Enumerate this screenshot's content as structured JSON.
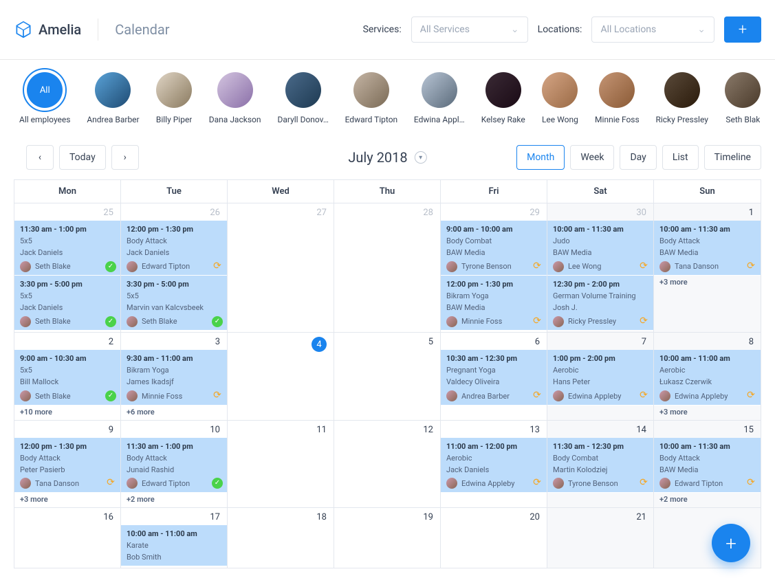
{
  "brand": "Amelia",
  "page_title": "Calendar",
  "filters": {
    "services_label": "Services:",
    "services_placeholder": "All Services",
    "locations_label": "Locations:",
    "locations_placeholder": "All Locations"
  },
  "employees": [
    {
      "name": "All employees",
      "all": true,
      "label": "All"
    },
    {
      "name": "Andrea Barber"
    },
    {
      "name": "Billy Piper"
    },
    {
      "name": "Dana Jackson"
    },
    {
      "name": "Daryll Donov…"
    },
    {
      "name": "Edward Tipton"
    },
    {
      "name": "Edwina Appl…"
    },
    {
      "name": "Kelsey Rake"
    },
    {
      "name": "Lee Wong"
    },
    {
      "name": "Minnie Foss"
    },
    {
      "name": "Ricky Pressley"
    },
    {
      "name": "Seth Blak"
    }
  ],
  "toolbar": {
    "today": "Today",
    "month_label": "July 2018",
    "views": [
      "Month",
      "Week",
      "Day",
      "List",
      "Timeline"
    ],
    "active_view": "Month"
  },
  "day_headers": [
    "Mon",
    "Tue",
    "Wed",
    "Thu",
    "Fri",
    "Sat",
    "Sun"
  ],
  "weeks": [
    [
      {
        "n": 25,
        "other": true,
        "events": [
          {
            "time": "11:30 am - 1:00 pm",
            "svc": "5x5",
            "loc": "Jack Daniels",
            "att": "Seth Blake",
            "status": "approved"
          },
          {
            "time": "3:30 pm - 5:00 pm",
            "svc": "5x5",
            "loc": "Jack Daniels",
            "att": "Seth Blake",
            "status": "approved"
          }
        ]
      },
      {
        "n": 26,
        "other": true,
        "events": [
          {
            "time": "12:00 pm - 1:30 pm",
            "svc": "Body Attack",
            "loc": "Jack Daniels",
            "att": "Edward Tipton",
            "status": "pending"
          },
          {
            "time": "3:30 pm - 5:00 pm",
            "svc": "5x5",
            "loc": "Marvin van Kalcvsbeek",
            "att": "Seth Blake",
            "status": "approved"
          }
        ]
      },
      {
        "n": 27,
        "other": true,
        "events": []
      },
      {
        "n": 28,
        "other": true,
        "events": []
      },
      {
        "n": 29,
        "other": true,
        "events": [
          {
            "time": "9:00 am - 10:00 am",
            "svc": "Body Combat",
            "loc": "BAW Media",
            "att": "Tyrone Benson",
            "status": "pending"
          },
          {
            "time": "12:00 pm - 1:30 pm",
            "svc": "Bikram Yoga",
            "loc": "BAW Media",
            "att": "Minnie Foss",
            "status": "pending"
          }
        ]
      },
      {
        "n": 30,
        "other": true,
        "weekend": true,
        "events": [
          {
            "time": "10:00 am - 11:30 am",
            "svc": "Judo",
            "loc": "BAW Media",
            "att": "Lee Wong",
            "status": "pending"
          },
          {
            "time": "12:30 pm - 2:00 pm",
            "svc": "German Volume Training",
            "loc": "Josh J.",
            "att": "Ricky Pressley",
            "status": "pending"
          }
        ]
      },
      {
        "n": 1,
        "weekend": true,
        "events": [
          {
            "time": "10:00 am - 11:30 am",
            "svc": "Body Attack",
            "loc": "BAW Media",
            "att": "Tana Danson",
            "status": "pending"
          }
        ],
        "more": "+3 more"
      }
    ],
    [
      {
        "n": 2,
        "events": [
          {
            "time": "9:00 am - 10:30 am",
            "svc": "5x5",
            "loc": "Bill Mallock",
            "att": "Seth Blake",
            "status": "approved"
          }
        ],
        "more": "+10 more"
      },
      {
        "n": 3,
        "events": [
          {
            "time": "9:30 am - 11:00 am",
            "svc": "Bikram Yoga",
            "loc": "James Ikadsjf",
            "att": "Minnie Foss",
            "status": "pending"
          }
        ],
        "more": "+6 more"
      },
      {
        "n": 4,
        "today": true,
        "events": []
      },
      {
        "n": 5,
        "events": []
      },
      {
        "n": 6,
        "events": [
          {
            "time": "10:30 am - 12:30 pm",
            "svc": "Pregnant Yoga",
            "loc": "Valdecy Oliveira",
            "att": "Andrea Barber",
            "status": "pending"
          }
        ]
      },
      {
        "n": 7,
        "weekend": true,
        "events": [
          {
            "time": "1:00 pm - 2:00 pm",
            "svc": "Aerobic",
            "loc": "Hans Peter",
            "att": "Edwina Appleby",
            "status": "pending"
          }
        ]
      },
      {
        "n": 8,
        "weekend": true,
        "events": [
          {
            "time": "10:00 am - 11:00 am",
            "svc": "Aerobic",
            "loc": "Łukasz Czerwik",
            "att": "Edwina Appleby",
            "status": "pending"
          }
        ],
        "more": "+3 more"
      }
    ],
    [
      {
        "n": 9,
        "events": [
          {
            "time": "12:00 pm - 1:30 pm",
            "svc": "Body Attack",
            "loc": "Peter Pasierb",
            "att": "Tana Danson",
            "status": "pending"
          }
        ],
        "more": "+3 more"
      },
      {
        "n": 10,
        "events": [
          {
            "time": "11:30 am - 1:00 pm",
            "svc": "Body Attack",
            "loc": "Junaid Rashid",
            "att": "Edward Tipton",
            "status": "approved"
          }
        ],
        "more": "+2 more"
      },
      {
        "n": 11,
        "events": []
      },
      {
        "n": 12,
        "events": []
      },
      {
        "n": 13,
        "events": [
          {
            "time": "11:00 am - 12:00 pm",
            "svc": "Aerobic",
            "loc": "Jack Daniels",
            "att": "Edwina Appleby",
            "status": "pending"
          }
        ]
      },
      {
        "n": 14,
        "weekend": true,
        "events": [
          {
            "time": "11:30 am - 12:30 pm",
            "svc": "Body Combat",
            "loc": "Martin Kolodziej",
            "att": "Tyrone Benson",
            "status": "pending"
          }
        ]
      },
      {
        "n": 15,
        "weekend": true,
        "events": [
          {
            "time": "10:00 am - 11:30 am",
            "svc": "Body Attack",
            "loc": "BAW Media",
            "att": "Edward Tipton",
            "status": "pending"
          }
        ],
        "more": "+2 more"
      }
    ],
    [
      {
        "n": 16,
        "events": []
      },
      {
        "n": 17,
        "events": [
          {
            "time": "10:00 am - 11:00 am",
            "svc": "Karate",
            "loc": "Bob Smith"
          }
        ]
      },
      {
        "n": 18,
        "events": []
      },
      {
        "n": 19,
        "events": []
      },
      {
        "n": 20,
        "events": []
      },
      {
        "n": 21,
        "weekend": true,
        "events": []
      },
      {
        "n": "",
        "weekend": true,
        "events": []
      }
    ]
  ]
}
